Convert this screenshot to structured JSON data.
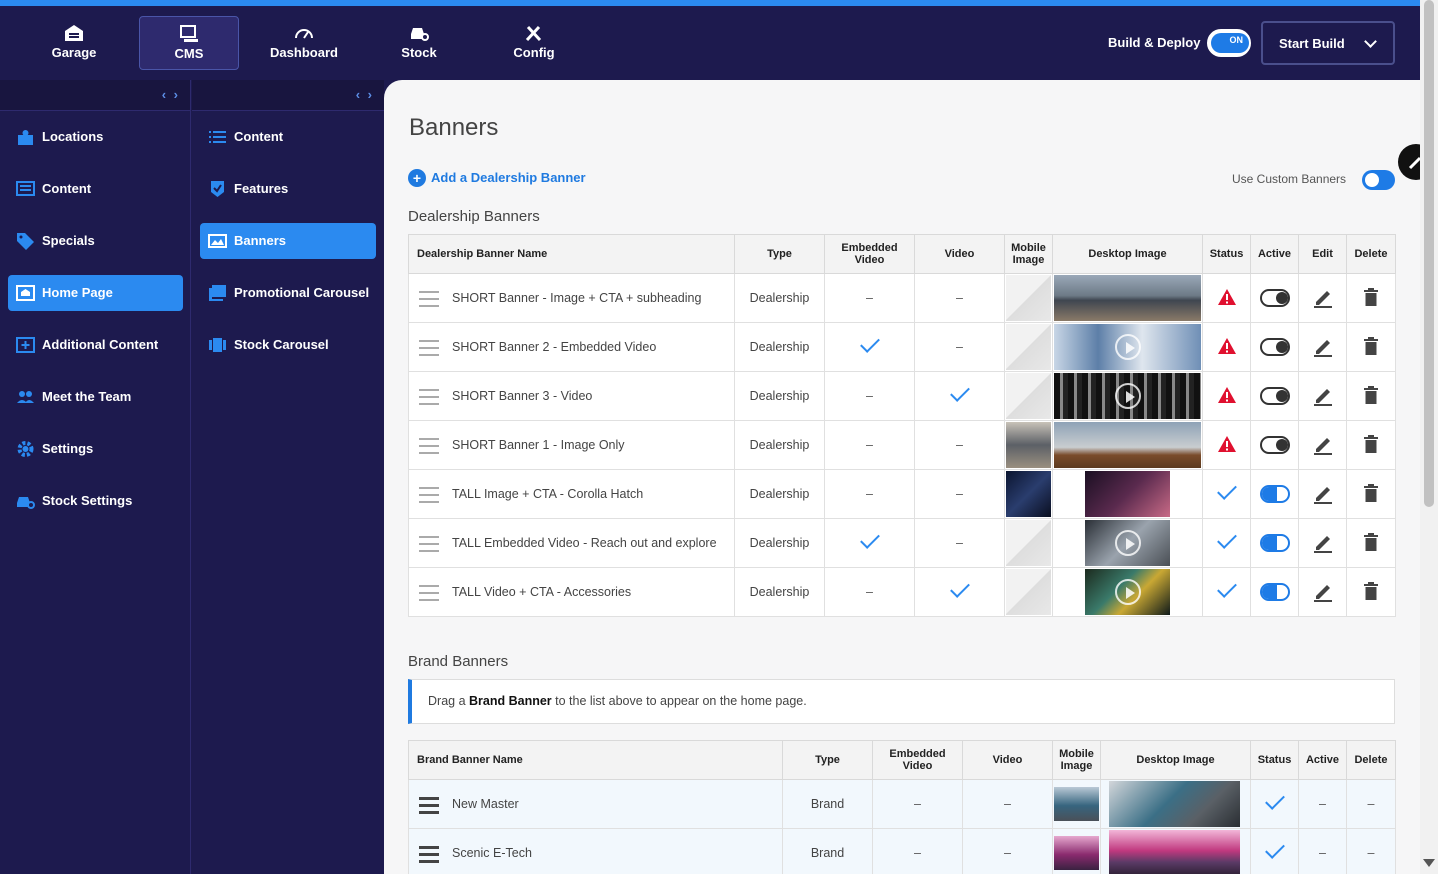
{
  "topnav": {
    "tabs": [
      {
        "label": "Garage",
        "icon": "garage-icon"
      },
      {
        "label": "CMS",
        "icon": "cms-icon",
        "active": true
      },
      {
        "label": "Dashboard",
        "icon": "dashboard-icon"
      },
      {
        "label": "Stock",
        "icon": "stock-icon"
      },
      {
        "label": "Config",
        "icon": "config-icon"
      }
    ],
    "build_label": "Build & Deploy",
    "toggle_text": "ON",
    "start_build": "Start Build"
  },
  "sidebar1": {
    "collapse": "‹ ›",
    "items": [
      {
        "label": "Locations"
      },
      {
        "label": "Content"
      },
      {
        "label": "Specials"
      },
      {
        "label": "Home Page",
        "active": true
      },
      {
        "label": "Additional Content"
      },
      {
        "label": "Meet the Team"
      },
      {
        "label": "Settings"
      },
      {
        "label": "Stock Settings"
      }
    ]
  },
  "sidebar2": {
    "collapse": "‹ ›",
    "items": [
      {
        "label": "Content"
      },
      {
        "label": "Features"
      },
      {
        "label": "Banners",
        "active": true
      },
      {
        "label": "Promotional Carousel"
      },
      {
        "label": "Stock Carousel"
      }
    ]
  },
  "main": {
    "title": "Banners",
    "add_link": "Add a Dealership Banner",
    "custom_label": "Use Custom Banners",
    "dealership_title": "Dealership Banners",
    "brand_title": "Brand Banners",
    "info_pre": "Drag a ",
    "info_bold": "Brand Banner",
    "info_post": " to the list above to appear on the home page.",
    "dealer_headers": {
      "name": "Dealership Banner Name",
      "type": "Type",
      "embedded": "Embedded Video",
      "video": "Video",
      "mobile": "Mobile Image",
      "desktop": "Desktop Image",
      "status": "Status",
      "active": "Active",
      "edit": "Edit",
      "delete": "Delete"
    },
    "dealer_rows": [
      {
        "name": "SHORT Banner - Image + CTA + subheading",
        "type": "Dealership",
        "embedded": "–",
        "video": "–"
      },
      {
        "name": "SHORT Banner 2 - Embedded Video",
        "type": "Dealership",
        "embedded": "",
        "video": "–"
      },
      {
        "name": "SHORT Banner 3 - Video",
        "type": "Dealership",
        "embedded": "–",
        "video": ""
      },
      {
        "name": "SHORT Banner 1 - Image Only",
        "type": "Dealership",
        "embedded": "–",
        "video": "–"
      },
      {
        "name": "TALL Image + CTA - Corolla Hatch",
        "type": "Dealership",
        "embedded": "–",
        "video": "–"
      },
      {
        "name": "TALL Embedded Video - Reach out and explore",
        "type": "Dealership",
        "embedded": "",
        "video": "–"
      },
      {
        "name": "TALL Video + CTA - Accessories",
        "type": "Dealership",
        "embedded": "–",
        "video": ""
      }
    ],
    "brand_headers": {
      "name": "Brand Banner Name",
      "type": "Type",
      "embedded": "Embedded Video",
      "video": "Video",
      "mobile": "Mobile Image",
      "desktop": "Desktop Image",
      "status": "Status",
      "active": "Active",
      "delete": "Delete"
    },
    "brand_rows": [
      {
        "name": "New Master",
        "type": "Brand",
        "embedded": "–",
        "video": "–",
        "active": "–",
        "delete": "–"
      },
      {
        "name": "Scenic E-Tech",
        "type": "Brand",
        "embedded": "–",
        "video": "–",
        "active": "–",
        "delete": "–"
      }
    ]
  },
  "colors": {
    "accent": "#2b8af0",
    "nav_bg": "#1d1a4e",
    "warning": "#e0102f"
  }
}
